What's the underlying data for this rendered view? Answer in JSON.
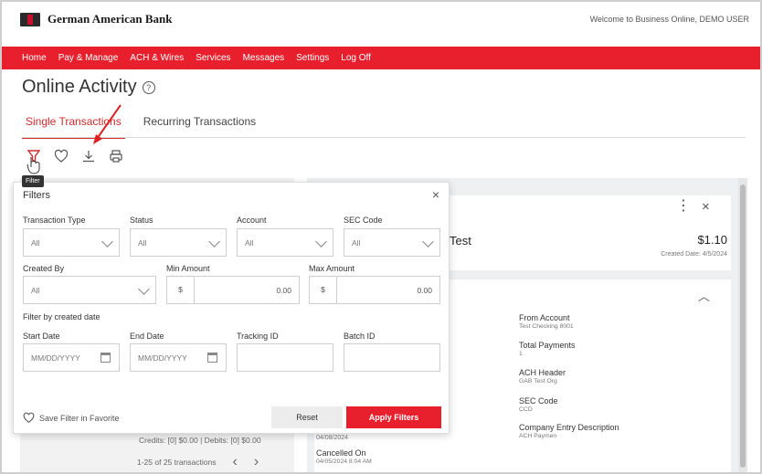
{
  "header": {
    "bank_name": "German American Bank",
    "welcome": "Welcome to Business Online, DEMO USER"
  },
  "nav": {
    "items": [
      "Home",
      "Pay & Manage",
      "ACH & Wires",
      "Services",
      "Messages",
      "Settings",
      "Log Off"
    ]
  },
  "page": {
    "title": "Online Activity",
    "info_icon_glyph": "?",
    "tabs": [
      {
        "label": "Single Transactions",
        "active": true
      },
      {
        "label": "Recurring Transactions",
        "active": false
      }
    ],
    "toolbar_icons": [
      "filter-icon",
      "heart-icon",
      "download-icon",
      "print-icon"
    ],
    "tooltip": "Filter"
  },
  "filters": {
    "title": "Filters",
    "close_glyph": "×",
    "transaction_type": {
      "label": "Transaction Type",
      "value": "All"
    },
    "status": {
      "label": "Status",
      "value": "All"
    },
    "account": {
      "label": "Account",
      "value": "All"
    },
    "sec_code": {
      "label": "SEC Code",
      "value": "All"
    },
    "created_by": {
      "label": "Created By",
      "value": "All"
    },
    "min_amount": {
      "label": "Min Amount",
      "currency": "$",
      "value": "0.00"
    },
    "max_amount": {
      "label": "Max Amount",
      "currency": "$",
      "value": "0.00"
    },
    "date_section": "Filter by created date",
    "start_date": {
      "label": "Start Date",
      "placeholder": "MM/DD/YYYY"
    },
    "end_date": {
      "label": "End Date",
      "placeholder": "MM/DD/YYYY"
    },
    "tracking_id": {
      "label": "Tracking ID",
      "value": ""
    },
    "batch_id": {
      "label": "Batch ID",
      "value": ""
    },
    "save_favorite": "Save Filter in Favorite",
    "reset": "Reset",
    "apply": "Apply Filters"
  },
  "list": {
    "credits_summary": "Credits: [0] $0.00 | Debits: [0] $0.00",
    "pagination": "1-25 of 25 transactions"
  },
  "detail": {
    "title_fragment": "Test",
    "kebab_glyph": "⋮",
    "close_glyph": "×",
    "caret_glyph": "︿",
    "amount": "$1.10",
    "created_date": "Created Date: 4/5/2024",
    "fields": [
      {
        "label": "From Account",
        "value": "Test Checking 8001"
      },
      {
        "label": "Total Payments",
        "value": "1"
      },
      {
        "label": "ACH Header",
        "value": "GAB Test Org"
      },
      {
        "label": "SEC Code",
        "value": "CCD"
      },
      {
        "label": "Company Entry Description",
        "value": "ACH Paymen"
      }
    ],
    "left_date": "04/08/2024",
    "cancelled_label": "Cancelled On",
    "cancelled_value": "04/05/2024 8:04 AM"
  }
}
